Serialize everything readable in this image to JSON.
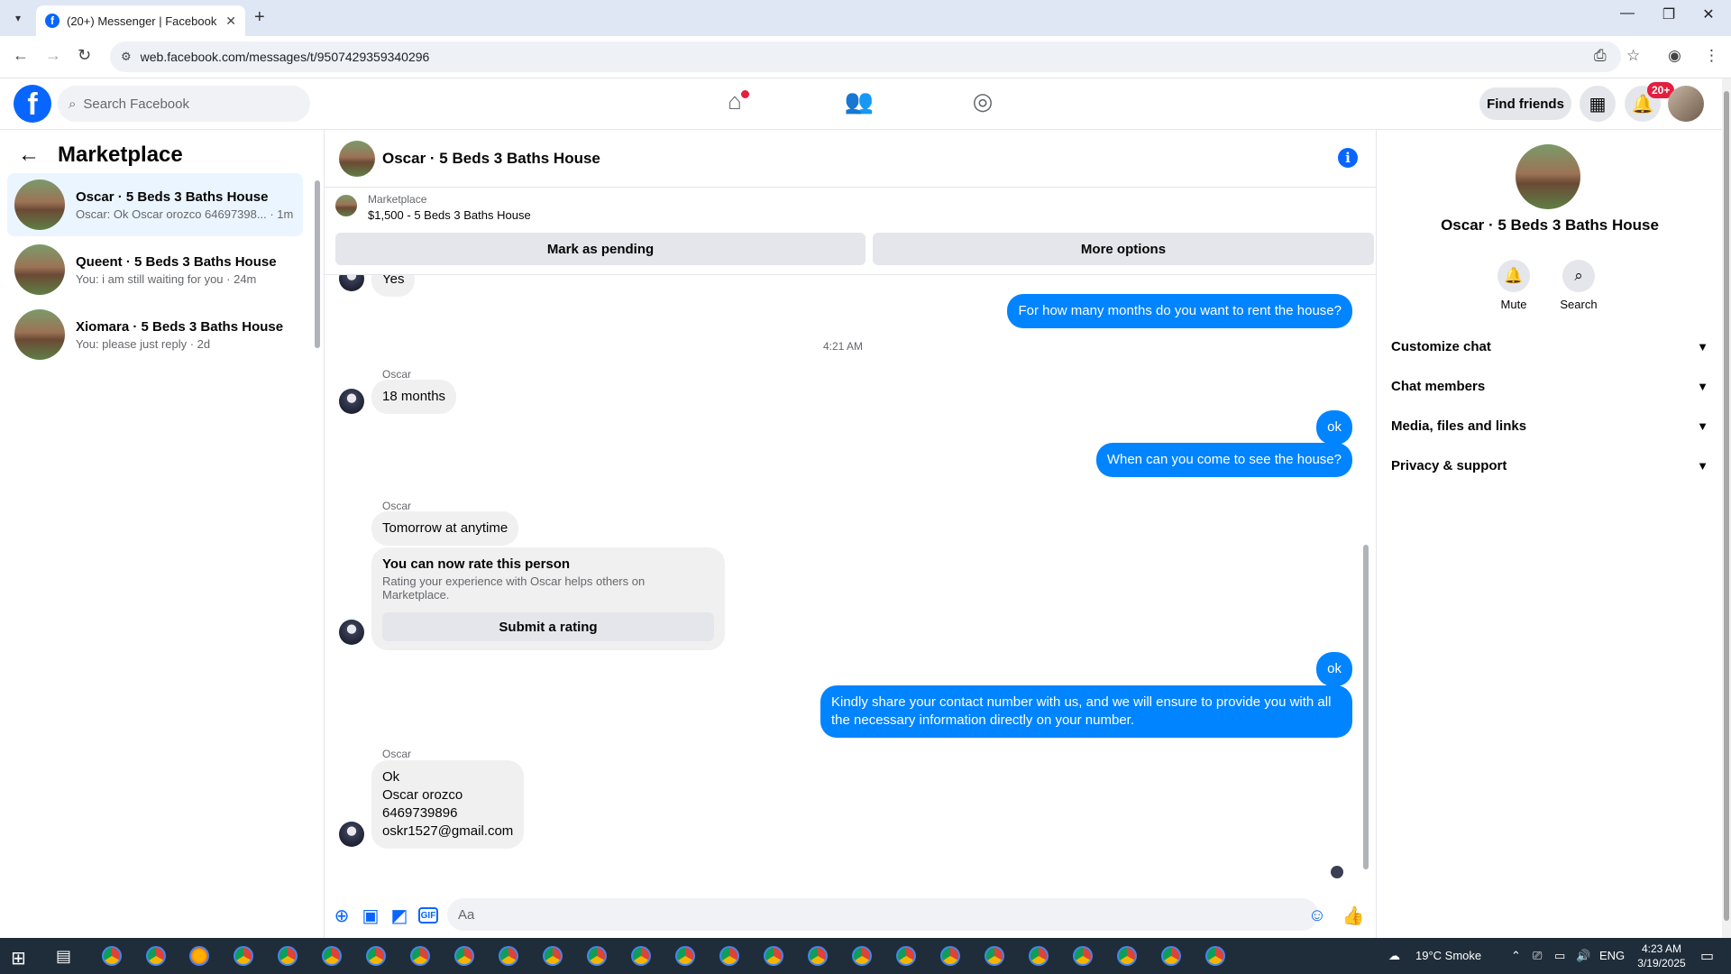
{
  "browser": {
    "tab_title": "(20+) Messenger | Facebook",
    "url": "web.facebook.com/messages/t/9507429359340296"
  },
  "header": {
    "search_placeholder": "Search Facebook",
    "find_friends_label": "Find friends",
    "notif_badge": "20+"
  },
  "left_panel": {
    "title": "Marketplace",
    "conversations": [
      {
        "name": "Oscar · 5 Beds 3 Baths House",
        "preview": "Oscar: Ok Oscar orozco 64697398... · 1m"
      },
      {
        "name": "Queent · 5 Beds 3 Baths House",
        "preview": "You: i am still waiting for you · 24m"
      },
      {
        "name": "Xiomara · 5 Beds 3 Baths House",
        "preview": "You: please just reply · 2d"
      }
    ]
  },
  "chat": {
    "title": "Oscar · 5 Beds 3 Baths House",
    "marketplace_label": "Marketplace",
    "listing": "$1,500 - 5 Beds 3 Baths House",
    "mark_pending_label": "Mark as pending",
    "more_options_label": "More options",
    "partial_msg": "Yes",
    "msg_out_1": "For how many months do you want to rent the house?",
    "time_sep": "4:21 AM",
    "sender": "Oscar",
    "msg_in_1": "18 months",
    "msg_out_2": "ok",
    "msg_out_3": "When can you come to see the house?",
    "msg_in_2": "Tomorrow at anytime",
    "rating_title": "You can now rate this person",
    "rating_sub": "Rating your experience with Oscar helps others on Marketplace.",
    "rating_button": "Submit a rating",
    "msg_out_4": "ok",
    "msg_out_5_l1": "Kindly share your contact number with us, and we will ensure to provide you with all",
    "msg_out_5_l2": "the necessary information directly on your number.",
    "msg_in_3": [
      "Ok",
      "Oscar orozco",
      "6469739896",
      "oskr1527@gmail.com"
    ],
    "composer_placeholder": "Aa",
    "gif_label": "GIF"
  },
  "right_panel": {
    "name": "Oscar · 5 Beds 3 Baths House",
    "mute_label": "Mute",
    "search_label": "Search",
    "rows": [
      "Customize chat",
      "Chat members",
      "Media, files and links",
      "Privacy & support"
    ]
  },
  "taskbar": {
    "weather": "19°C  Smoke",
    "lang": "ENG",
    "time": "4:23 AM",
    "date": "3/19/2025"
  }
}
